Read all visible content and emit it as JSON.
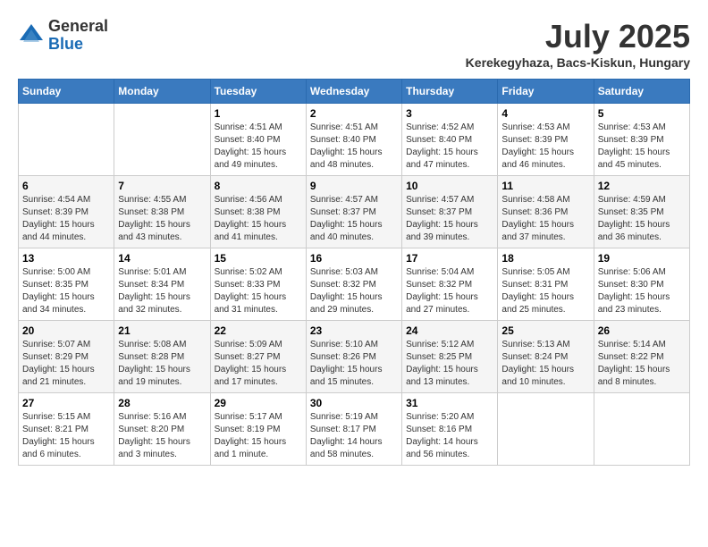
{
  "header": {
    "logo_general": "General",
    "logo_blue": "Blue",
    "month_title": "July 2025",
    "location": "Kerekegyhaza, Bacs-Kiskun, Hungary"
  },
  "days_of_week": [
    "Sunday",
    "Monday",
    "Tuesday",
    "Wednesday",
    "Thursday",
    "Friday",
    "Saturday"
  ],
  "weeks": [
    [
      {
        "day": "",
        "sunrise": "",
        "sunset": "",
        "daylight": ""
      },
      {
        "day": "",
        "sunrise": "",
        "sunset": "",
        "daylight": ""
      },
      {
        "day": "1",
        "sunrise": "Sunrise: 4:51 AM",
        "sunset": "Sunset: 8:40 PM",
        "daylight": "Daylight: 15 hours and 49 minutes."
      },
      {
        "day": "2",
        "sunrise": "Sunrise: 4:51 AM",
        "sunset": "Sunset: 8:40 PM",
        "daylight": "Daylight: 15 hours and 48 minutes."
      },
      {
        "day": "3",
        "sunrise": "Sunrise: 4:52 AM",
        "sunset": "Sunset: 8:40 PM",
        "daylight": "Daylight: 15 hours and 47 minutes."
      },
      {
        "day": "4",
        "sunrise": "Sunrise: 4:53 AM",
        "sunset": "Sunset: 8:39 PM",
        "daylight": "Daylight: 15 hours and 46 minutes."
      },
      {
        "day": "5",
        "sunrise": "Sunrise: 4:53 AM",
        "sunset": "Sunset: 8:39 PM",
        "daylight": "Daylight: 15 hours and 45 minutes."
      }
    ],
    [
      {
        "day": "6",
        "sunrise": "Sunrise: 4:54 AM",
        "sunset": "Sunset: 8:39 PM",
        "daylight": "Daylight: 15 hours and 44 minutes."
      },
      {
        "day": "7",
        "sunrise": "Sunrise: 4:55 AM",
        "sunset": "Sunset: 8:38 PM",
        "daylight": "Daylight: 15 hours and 43 minutes."
      },
      {
        "day": "8",
        "sunrise": "Sunrise: 4:56 AM",
        "sunset": "Sunset: 8:38 PM",
        "daylight": "Daylight: 15 hours and 41 minutes."
      },
      {
        "day": "9",
        "sunrise": "Sunrise: 4:57 AM",
        "sunset": "Sunset: 8:37 PM",
        "daylight": "Daylight: 15 hours and 40 minutes."
      },
      {
        "day": "10",
        "sunrise": "Sunrise: 4:57 AM",
        "sunset": "Sunset: 8:37 PM",
        "daylight": "Daylight: 15 hours and 39 minutes."
      },
      {
        "day": "11",
        "sunrise": "Sunrise: 4:58 AM",
        "sunset": "Sunset: 8:36 PM",
        "daylight": "Daylight: 15 hours and 37 minutes."
      },
      {
        "day": "12",
        "sunrise": "Sunrise: 4:59 AM",
        "sunset": "Sunset: 8:35 PM",
        "daylight": "Daylight: 15 hours and 36 minutes."
      }
    ],
    [
      {
        "day": "13",
        "sunrise": "Sunrise: 5:00 AM",
        "sunset": "Sunset: 8:35 PM",
        "daylight": "Daylight: 15 hours and 34 minutes."
      },
      {
        "day": "14",
        "sunrise": "Sunrise: 5:01 AM",
        "sunset": "Sunset: 8:34 PM",
        "daylight": "Daylight: 15 hours and 32 minutes."
      },
      {
        "day": "15",
        "sunrise": "Sunrise: 5:02 AM",
        "sunset": "Sunset: 8:33 PM",
        "daylight": "Daylight: 15 hours and 31 minutes."
      },
      {
        "day": "16",
        "sunrise": "Sunrise: 5:03 AM",
        "sunset": "Sunset: 8:32 PM",
        "daylight": "Daylight: 15 hours and 29 minutes."
      },
      {
        "day": "17",
        "sunrise": "Sunrise: 5:04 AM",
        "sunset": "Sunset: 8:32 PM",
        "daylight": "Daylight: 15 hours and 27 minutes."
      },
      {
        "day": "18",
        "sunrise": "Sunrise: 5:05 AM",
        "sunset": "Sunset: 8:31 PM",
        "daylight": "Daylight: 15 hours and 25 minutes."
      },
      {
        "day": "19",
        "sunrise": "Sunrise: 5:06 AM",
        "sunset": "Sunset: 8:30 PM",
        "daylight": "Daylight: 15 hours and 23 minutes."
      }
    ],
    [
      {
        "day": "20",
        "sunrise": "Sunrise: 5:07 AM",
        "sunset": "Sunset: 8:29 PM",
        "daylight": "Daylight: 15 hours and 21 minutes."
      },
      {
        "day": "21",
        "sunrise": "Sunrise: 5:08 AM",
        "sunset": "Sunset: 8:28 PM",
        "daylight": "Daylight: 15 hours and 19 minutes."
      },
      {
        "day": "22",
        "sunrise": "Sunrise: 5:09 AM",
        "sunset": "Sunset: 8:27 PM",
        "daylight": "Daylight: 15 hours and 17 minutes."
      },
      {
        "day": "23",
        "sunrise": "Sunrise: 5:10 AM",
        "sunset": "Sunset: 8:26 PM",
        "daylight": "Daylight: 15 hours and 15 minutes."
      },
      {
        "day": "24",
        "sunrise": "Sunrise: 5:12 AM",
        "sunset": "Sunset: 8:25 PM",
        "daylight": "Daylight: 15 hours and 13 minutes."
      },
      {
        "day": "25",
        "sunrise": "Sunrise: 5:13 AM",
        "sunset": "Sunset: 8:24 PM",
        "daylight": "Daylight: 15 hours and 10 minutes."
      },
      {
        "day": "26",
        "sunrise": "Sunrise: 5:14 AM",
        "sunset": "Sunset: 8:22 PM",
        "daylight": "Daylight: 15 hours and 8 minutes."
      }
    ],
    [
      {
        "day": "27",
        "sunrise": "Sunrise: 5:15 AM",
        "sunset": "Sunset: 8:21 PM",
        "daylight": "Daylight: 15 hours and 6 minutes."
      },
      {
        "day": "28",
        "sunrise": "Sunrise: 5:16 AM",
        "sunset": "Sunset: 8:20 PM",
        "daylight": "Daylight: 15 hours and 3 minutes."
      },
      {
        "day": "29",
        "sunrise": "Sunrise: 5:17 AM",
        "sunset": "Sunset: 8:19 PM",
        "daylight": "Daylight: 15 hours and 1 minute."
      },
      {
        "day": "30",
        "sunrise": "Sunrise: 5:19 AM",
        "sunset": "Sunset: 8:17 PM",
        "daylight": "Daylight: 14 hours and 58 minutes."
      },
      {
        "day": "31",
        "sunrise": "Sunrise: 5:20 AM",
        "sunset": "Sunset: 8:16 PM",
        "daylight": "Daylight: 14 hours and 56 minutes."
      },
      {
        "day": "",
        "sunrise": "",
        "sunset": "",
        "daylight": ""
      },
      {
        "day": "",
        "sunrise": "",
        "sunset": "",
        "daylight": ""
      }
    ]
  ]
}
